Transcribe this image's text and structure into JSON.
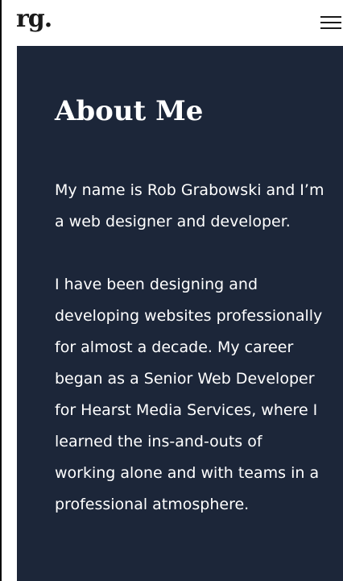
{
  "header": {
    "logo": "rg.",
    "menu_icon": "hamburger-menu-icon"
  },
  "about": {
    "title": "About Me",
    "paragraphs": [
      "My name is Rob Grabowski and I’m a web designer and developer.",
      "I have been designing and developing websites professionally for almost a decade. My career began as a Senior Web Developer for Hearst Media Services, where I learned the ins-and-outs of working alone and with teams in a professional atmosphere."
    ]
  },
  "colors": {
    "content_background": "#1c2639",
    "text_light": "#ffffff",
    "text_dark": "#1a1a1a"
  }
}
